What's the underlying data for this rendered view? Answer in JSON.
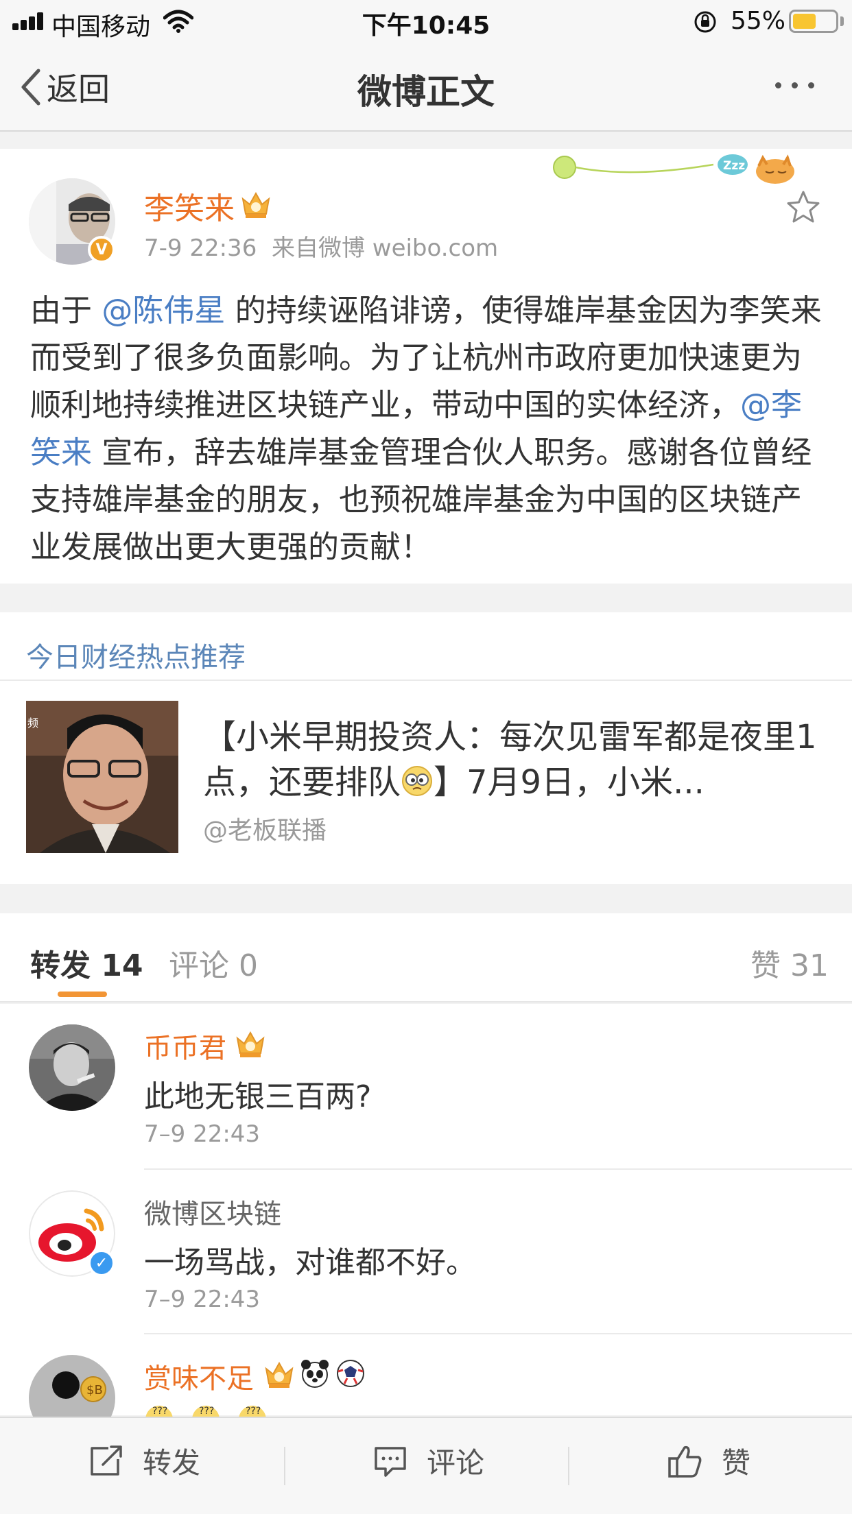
{
  "status_bar": {
    "carrier": "中国移动",
    "time": "下午10:45",
    "battery": "55%",
    "battery_level": 0.55
  },
  "nav": {
    "back_label": "返回",
    "title": "微博正文"
  },
  "post": {
    "author": "李笑来",
    "time": "7-9 22:36",
    "source": "来自微博 weibo.com",
    "text_parts": {
      "p1": "由于 ",
      "m1": "@陈伟星",
      "p2": " 的持续诬陷诽谤，使得雄岸基金因为李笑来而受到了很多负面影响。为了让杭州市政府更加快速更为顺利地持续推进区块链产业，带动中国的实体经济，",
      "m2": "@李笑来",
      "p3": " 宣布，辞去雄岸基金管理合伙人职务。感谢各位曾经支持雄岸基金的朋友，也预祝雄岸基金为中国的区块链产业发展做出更大更强的贡献！"
    }
  },
  "hot": {
    "header": "今日财经热点推荐",
    "title_a": "【小米早期投资人：每次见雷军都是夜里1点，还要排队",
    "title_b": "】7月9日，小米...",
    "source": "@老板联播",
    "thumb_label": "频"
  },
  "tabs": {
    "repost": "转发 14",
    "comment": "评论 0",
    "like": "赞 31"
  },
  "comments": [
    {
      "name": "币币君",
      "text": "此地无银三百两?",
      "time": "7–9 22:43"
    },
    {
      "name": "微博区块链",
      "text": "一场骂战，对谁都不好。",
      "time": "7–9 22:43"
    },
    {
      "name": "赏味不足"
    }
  ],
  "bottom": {
    "repost": "转发",
    "comment": "评论",
    "like": "赞"
  },
  "colors": {
    "accent_orange": "#eb7125",
    "link_blue": "#4a7ec4",
    "tab_underline": "#f29535",
    "battery": "#f8c531"
  }
}
